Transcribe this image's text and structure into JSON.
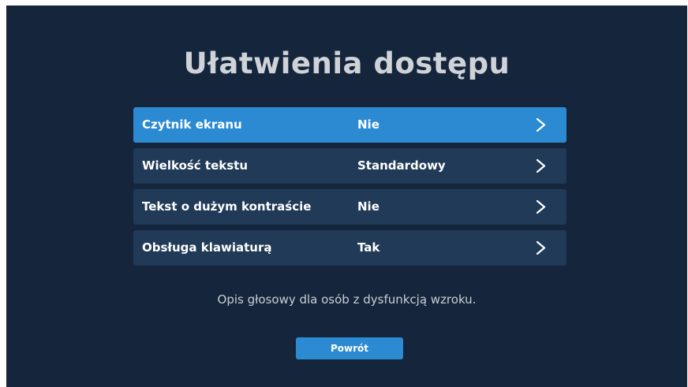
{
  "screen": {
    "title": "Ułatwienia dostępu",
    "description": "Opis głosowy dla osób z dysfunkcją wzroku.",
    "back_label": "Powrót"
  },
  "menu": {
    "items": [
      {
        "label": "Czytnik ekranu",
        "value": "Nie",
        "selected": true
      },
      {
        "label": "Wielkość tekstu",
        "value": "Standardowy",
        "selected": false
      },
      {
        "label": "Tekst o dużym kontraście",
        "value": "Nie",
        "selected": false
      },
      {
        "label": "Obsługa klawiaturą",
        "value": "Tak",
        "selected": false
      }
    ],
    "icon": "chevron-right-icon"
  },
  "colors": {
    "background": "#14253c",
    "row": "#203a58",
    "accent": "#2b8ad2",
    "title": "#cfd3d8"
  }
}
